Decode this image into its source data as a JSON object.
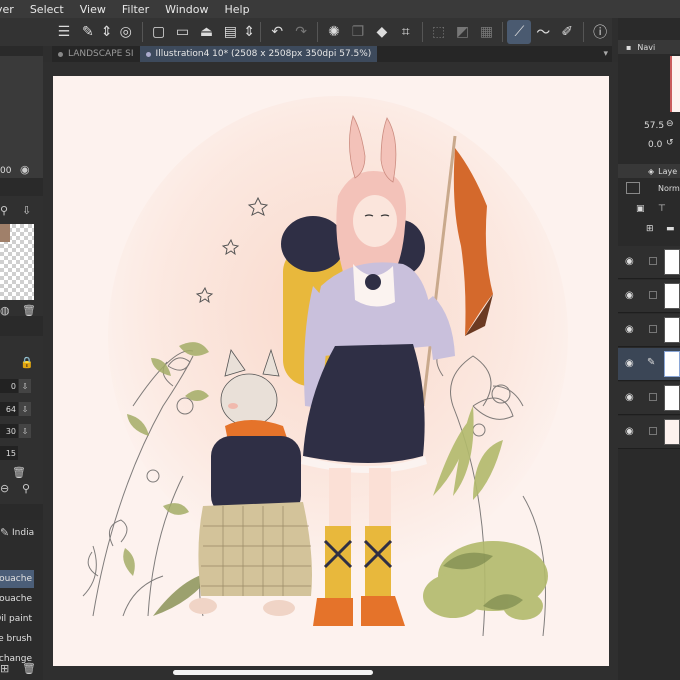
{
  "menubar": {
    "items": [
      "yer",
      "Select",
      "View",
      "Filter",
      "Window",
      "Help"
    ]
  },
  "tabs": [
    {
      "label": "LANDSCAPE SI",
      "active": false
    },
    {
      "label": "Illustration4 10* (2508 x 2508px 350dpi 57.5%)",
      "active": true
    }
  ],
  "left_panel": {
    "value_top": "00",
    "number_fields": [
      "0",
      "64",
      "30",
      "15"
    ],
    "brush_category": "India",
    "brushes": [
      {
        "label": "Gouache",
        "selected": true
      },
      {
        "label": "Gouache",
        "selected": false
      },
      {
        "label": "Oil paint",
        "selected": false
      },
      {
        "label": "ne brush",
        "selected": false
      },
      {
        "label": "change",
        "selected": false
      }
    ]
  },
  "right_panel": {
    "navigator_label": "Navi",
    "zoom_value": "57.5",
    "rotation_value": "0.0",
    "layer_label": "Laye",
    "blend_mode": "Norma",
    "layers": [
      {
        "visible": true,
        "selected": false,
        "editing": false
      },
      {
        "visible": true,
        "selected": false,
        "editing": false
      },
      {
        "visible": true,
        "selected": false,
        "editing": false
      },
      {
        "visible": true,
        "selected": true,
        "editing": true
      },
      {
        "visible": true,
        "selected": false,
        "editing": false
      },
      {
        "visible": true,
        "selected": false,
        "editing": false
      }
    ]
  },
  "colors": {
    "accent": "#4b5e78",
    "canvas_paper": "#fdf2ee",
    "flag": "#d4692c",
    "skirt": "#2f2f45",
    "shirt": "#c9c0dc",
    "backpack": "#e8b83c",
    "scarf": "#e5732a",
    "hair": "#f3c2b9"
  }
}
